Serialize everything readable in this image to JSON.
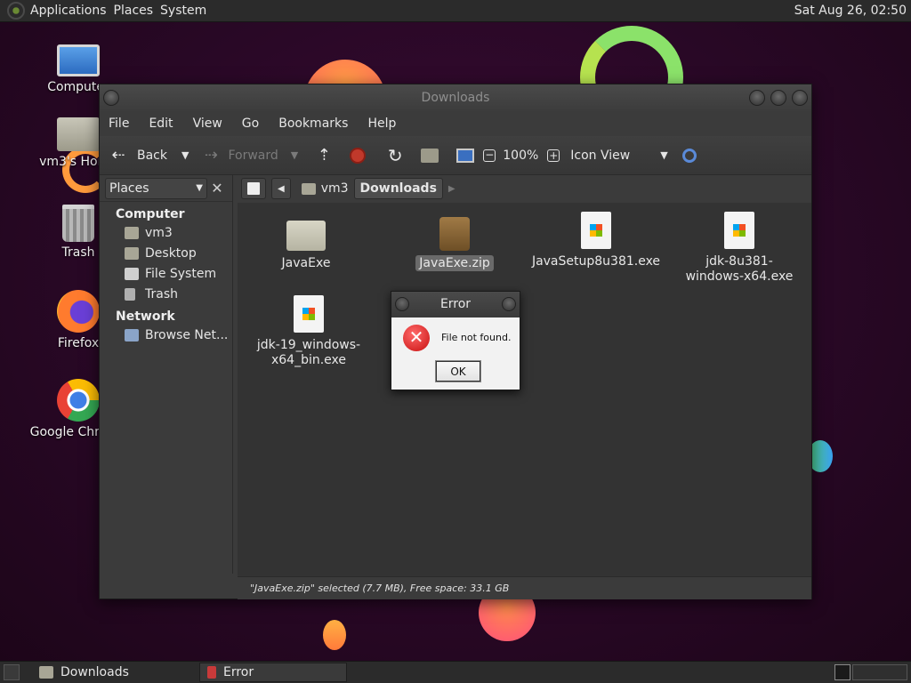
{
  "top_panel": {
    "menus": [
      "Applications",
      "Places",
      "System"
    ],
    "clock": "Sat Aug 26, 02:50"
  },
  "desktop_icons": [
    {
      "label": "Computer",
      "icon": "computer-icon"
    },
    {
      "label": "vm3's Home",
      "icon": "home-folder-icon"
    },
    {
      "label": "Trash",
      "icon": "trash-icon"
    },
    {
      "label": "Firefox",
      "icon": "firefox-icon"
    },
    {
      "label": "Google Chrome",
      "icon": "chrome-icon"
    }
  ],
  "window": {
    "title": "Downloads",
    "menubar": [
      "File",
      "Edit",
      "View",
      "Go",
      "Bookmarks",
      "Help"
    ],
    "toolbar": {
      "back": "Back",
      "forward": "Forward",
      "zoom": "100%",
      "view_mode": "Icon View"
    },
    "sidebar": {
      "selector": "Places",
      "sections": [
        {
          "title": "Computer",
          "items": [
            "vm3",
            "Desktop",
            "File System",
            "Trash"
          ]
        },
        {
          "title": "Network",
          "items": [
            "Browse Net..."
          ]
        }
      ]
    },
    "pathbar": [
      "vm3",
      "Downloads"
    ],
    "files": [
      {
        "name": "JavaExe",
        "type": "folder"
      },
      {
        "name": "JavaExe.zip",
        "type": "zip",
        "selected": true
      },
      {
        "name": "JavaSetup8u381.exe",
        "type": "exe"
      },
      {
        "name": "jdk-8u381-windows-x64.exe",
        "type": "exe"
      },
      {
        "name": "jdk-19_windows-x64_bin.exe",
        "type": "exe"
      }
    ],
    "status": "\"JavaExe.zip\" selected (7.7 MB), Free space: 33.1 GB"
  },
  "dialog": {
    "title": "Error",
    "message": "File not found.",
    "ok": "OK"
  },
  "taskbar": {
    "items": [
      {
        "label": "Downloads"
      },
      {
        "label": "Error"
      }
    ]
  }
}
